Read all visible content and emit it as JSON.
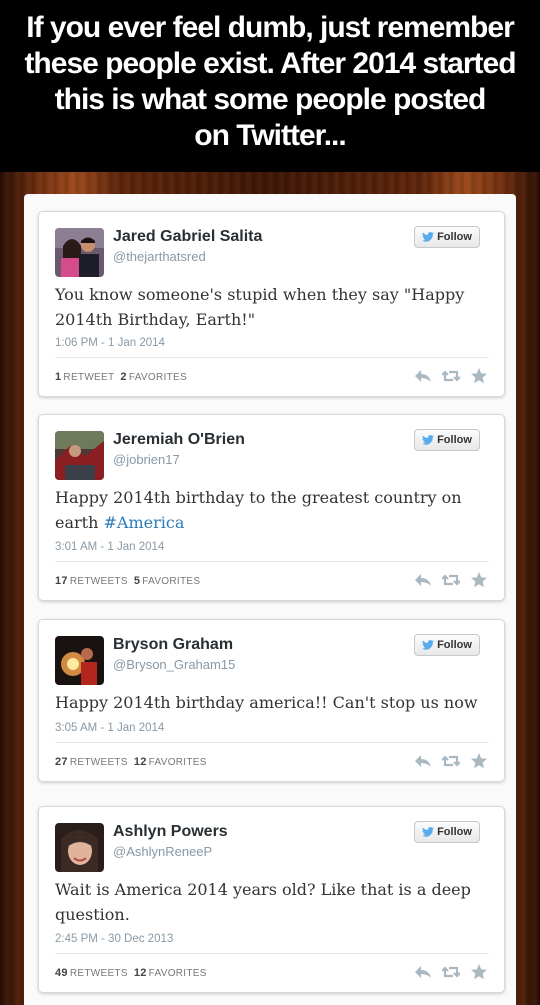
{
  "header": {
    "lines": [
      "If you ever feel dumb, just remember",
      "these people exist. After 2014 started",
      "this is what some people posted",
      "on Twitter..."
    ]
  },
  "follow_label": "Follow",
  "colors": {
    "link": "#2b7bb9",
    "twitter_blue": "#55acee",
    "header_bg": "#000000"
  },
  "tweets": [
    {
      "name": "Jared Gabriel Salita",
      "handle": "@thejarthatsred",
      "text": "You know someone's stupid when they say \"Happy 2014th Birthday, Earth!\"",
      "hashtag": "",
      "time": "1:06 PM - 1 Jan 2014",
      "retweets": "1",
      "retweets_label": "RETWEET",
      "favorites": "2",
      "favorites_label": "FAVORITES"
    },
    {
      "name": "Jeremiah O'Brien",
      "handle": "@jobrien17",
      "text": "Happy 2014th birthday to the greatest country on earth ",
      "hashtag": "#America",
      "time": "3:01 AM - 1 Jan 2014",
      "retweets": "17",
      "retweets_label": "RETWEETS",
      "favorites": "5",
      "favorites_label": "FAVORITES"
    },
    {
      "name": "Bryson Graham",
      "handle": "@Bryson_Graham15",
      "text": "Happy 2014th birthday america!! Can't stop us now",
      "hashtag": "",
      "time": "3:05 AM - 1 Jan 2014",
      "retweets": "27",
      "retweets_label": "RETWEETS",
      "favorites": "12",
      "favorites_label": "FAVORITES"
    },
    {
      "name": "Ashlyn Powers",
      "handle": "@AshlynReneeP",
      "text": "Wait is America 2014 years old? Like that is a deep question.",
      "hashtag": "",
      "time": "2:45 PM - 30 Dec 2013",
      "retweets": "49",
      "retweets_label": "RETWEETS",
      "favorites": "12",
      "favorites_label": "FAVORITES"
    }
  ]
}
